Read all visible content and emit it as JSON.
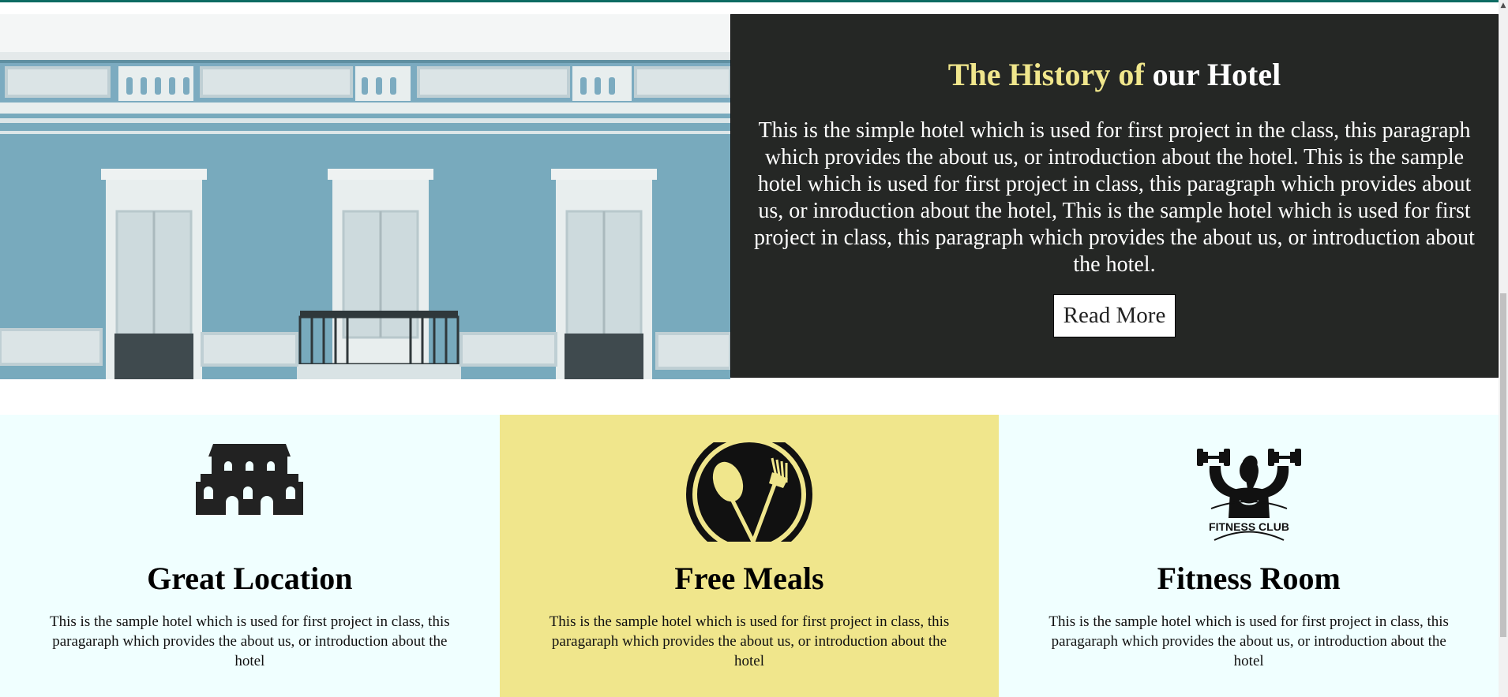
{
  "history": {
    "title_accent": "The History of",
    "title_main": "our Hotel",
    "text": "This is the simple hotel which is used for first project in the class, this paragraph which provides the about us, or introduction about the hotel. This is the sample hotel which is used for first project in class, this paragraph which provides about us, or inroduction about the hotel, This is the sample hotel which is used for first project in class, this paragraph which provides the about us, or introduction about the hotel.",
    "button_label": "Read More"
  },
  "features": [
    {
      "icon": "hotel-building-icon",
      "title": "Great Location",
      "text": "This is the sample hotel which is used for first project in class, this paragaraph which provides the about us, or introduction about the hotel"
    },
    {
      "icon": "spoon-fork-icon",
      "title": "Free Meals",
      "text": "This is the sample hotel which is used for first project in class, this paragaraph which provides the about us, or introduction about the hotel"
    },
    {
      "icon": "fitness-club-icon",
      "title": "Fitness Room",
      "icon_text": "FITNESS CLUB",
      "text": "This is the sample hotel which is used for first project in class, this paragaraph which provides the about us, or introduction about the hotel"
    }
  ],
  "colors": {
    "accent": "#f0e68c",
    "panel_bg": "#252725",
    "feature_bg": "#f0ffff",
    "top_bar": "#0d6b63"
  }
}
